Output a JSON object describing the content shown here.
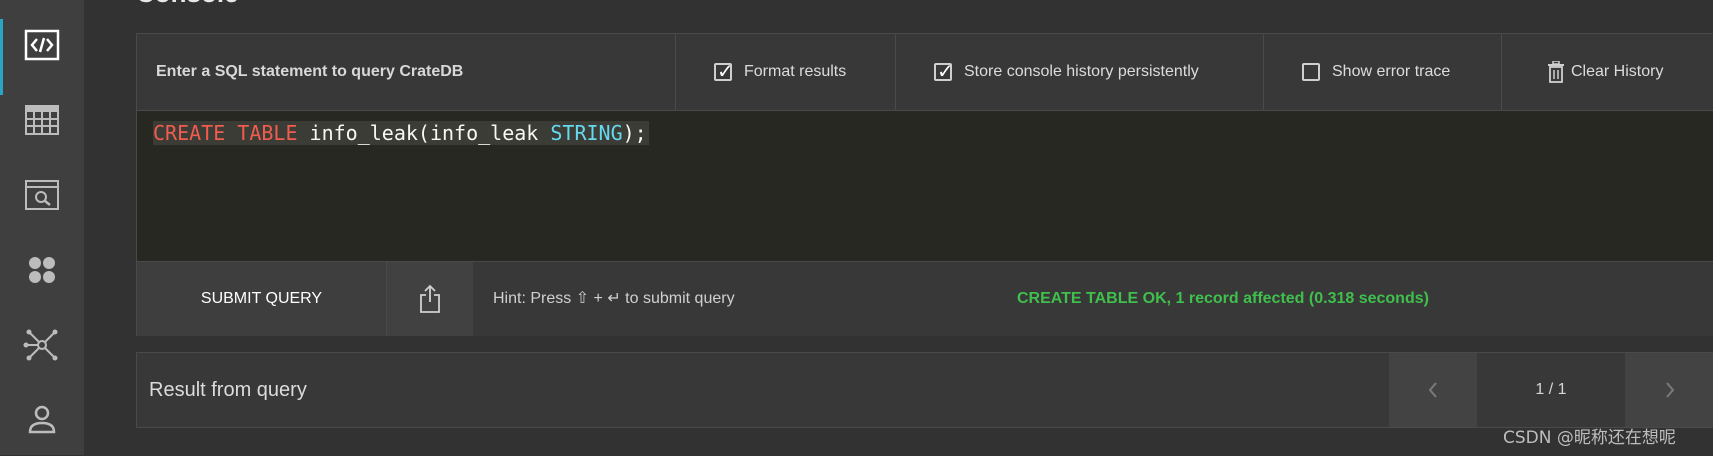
{
  "page": {
    "title": "Console"
  },
  "sidebar": {
    "items": [
      {
        "icon": "code-icon",
        "active": true
      },
      {
        "icon": "table-icon",
        "active": false
      },
      {
        "icon": "search-window-icon",
        "active": false
      },
      {
        "icon": "cluster-icon",
        "active": false
      },
      {
        "icon": "network-icon",
        "active": false
      },
      {
        "icon": "user-icon",
        "active": false
      }
    ]
  },
  "toolbar": {
    "prompt": "Enter a SQL statement to query CrateDB",
    "format_results": {
      "label": "Format results",
      "checked": true
    },
    "store_history": {
      "label": "Store console history persistently",
      "checked": true
    },
    "show_error_trace": {
      "label": "Show error trace",
      "checked": false
    },
    "clear_history": {
      "label": "Clear History",
      "icon": "trash-icon"
    }
  },
  "editor": {
    "tokens": [
      {
        "text": "CREATE",
        "kind": "keyword"
      },
      {
        "text": " ",
        "kind": "text"
      },
      {
        "text": "TABLE",
        "kind": "keyword"
      },
      {
        "text": " info_leak(info_leak ",
        "kind": "text"
      },
      {
        "text": "STRING",
        "kind": "type"
      },
      {
        "text": ");",
        "kind": "text"
      }
    ]
  },
  "actions": {
    "submit_label": "SUBMIT QUERY",
    "share_icon": "share-icon",
    "hint": "Hint: Press ⇧ + ↵ to submit query",
    "status": "CREATE TABLE OK, 1 record affected (0.318 seconds)"
  },
  "results": {
    "title": "Result from query",
    "page_indicator": "1 / 1"
  },
  "watermark": "CSDN @昵称还在想呢",
  "colors": {
    "background": "#323232",
    "sidebar": "#3f3f3f",
    "accent": "#2aa6c4",
    "editor_bg": "#272822",
    "keyword": "#f25c4f",
    "type": "#66d9ef",
    "success": "#3fbf4c"
  }
}
